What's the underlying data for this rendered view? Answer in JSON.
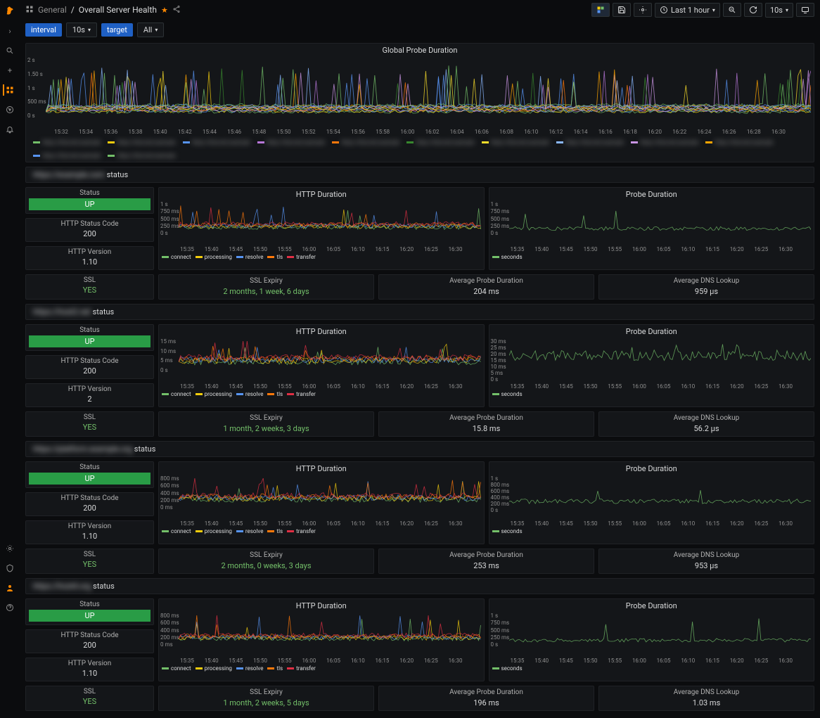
{
  "breadcrumb": {
    "icon": "panel-grid",
    "folder": "General",
    "sep": "/",
    "title": "Overall Server Health"
  },
  "topbar": {
    "timerange": "Last 1 hour",
    "refresh": "10s",
    "buttons": [
      "add-panel",
      "save",
      "settings",
      "time",
      "zoom-out",
      "cycle",
      "refresh-rate",
      "tv"
    ]
  },
  "vars": [
    {
      "label": "interval",
      "value": "10s"
    },
    {
      "label": "target",
      "value": "All"
    }
  ],
  "chart_data": {
    "global": {
      "type": "line",
      "title": "Global Probe Duration",
      "ylabel": "",
      "ylim": [
        0,
        2
      ],
      "yticks": [
        "0 s",
        "500 ms",
        "1 s",
        "1.50 s",
        "2 s"
      ],
      "xticks": [
        "15:32",
        "15:34",
        "15:36",
        "15:38",
        "15:40",
        "15:42",
        "15:44",
        "15:46",
        "15:48",
        "15:50",
        "15:52",
        "15:54",
        "15:56",
        "15:58",
        "16:00",
        "16:02",
        "16:04",
        "16:06",
        "16:08",
        "16:10",
        "16:12",
        "16:14",
        "16:16",
        "16:18",
        "16:20",
        "16:22",
        "16:24",
        "16:26",
        "16:28",
        "16:30"
      ],
      "legend_colors": [
        "#73bf69",
        "#f2cc0c",
        "#5794f2",
        "#b877d9",
        "#ff780a",
        "#37872d",
        "#fade2a",
        "#8ab8ff",
        "#ca95e5",
        "#ffa500",
        "#5794f2",
        "#73bf69"
      ],
      "series_count": 12,
      "baseline_ms": 200,
      "spike_ms": 1600
    },
    "xticks_short": [
      "15:35",
      "15:40",
      "15:45",
      "15:50",
      "15:55",
      "16:00",
      "16:05",
      "16:10",
      "16:15",
      "16:20",
      "16:25",
      "16:30"
    ],
    "http_series": [
      {
        "name": "connect",
        "color": "#73bf69"
      },
      {
        "name": "processing",
        "color": "#f2cc0c"
      },
      {
        "name": "resolve",
        "color": "#5794f2"
      },
      {
        "name": "tls",
        "color": "#ff780a"
      },
      {
        "name": "transfer",
        "color": "#e02f44"
      }
    ],
    "probe_series": [
      {
        "name": "seconds",
        "color": "#73bf69"
      }
    ]
  },
  "rows": [
    {
      "name_blurred": "https://example.com",
      "status_suffix": " status",
      "stats": {
        "status": {
          "title": "Status",
          "value": "UP"
        },
        "code": {
          "title": "HTTP Status Code",
          "value": "200"
        },
        "version": {
          "title": "HTTP Version",
          "value": "1.10"
        },
        "ssl": {
          "title": "SSL",
          "value": "YES"
        }
      },
      "http": {
        "title": "HTTP Duration",
        "yticks": [
          "0 s",
          "250 ms",
          "500 ms",
          "750 ms",
          "1 s"
        ],
        "ylim_ms": [
          0,
          1000
        ],
        "baseline_ms": 250,
        "spike_ms": 900
      },
      "probe": {
        "title": "Probe Duration",
        "yticks": [
          "0 s",
          "250 ms",
          "500 ms",
          "750 ms",
          "1 s"
        ],
        "ylim_ms": [
          0,
          1000
        ],
        "baseline_ms": 204,
        "spike_ms": 950
      },
      "expiry": {
        "title": "SSL Expiry",
        "value": "2 months, 1 week, 6 days"
      },
      "avg_probe": {
        "title": "Average Probe Duration",
        "value": "204 ms"
      },
      "avg_dns": {
        "title": "Average DNS Lookup",
        "value": "959 µs"
      }
    },
    {
      "name_blurred": "https://host2.net",
      "status_suffix": " status",
      "stats": {
        "status": {
          "title": "Status",
          "value": "UP"
        },
        "code": {
          "title": "HTTP Status Code",
          "value": "200"
        },
        "version": {
          "title": "HTTP Version",
          "value": "2"
        },
        "ssl": {
          "title": "SSL",
          "value": "YES"
        }
      },
      "http": {
        "title": "HTTP Duration",
        "yticks": [
          "0 s",
          "5 ms",
          "10 ms",
          "15 ms"
        ],
        "ylim_ms": [
          0,
          15
        ],
        "baseline_ms": 5,
        "spike_ms": 14
      },
      "probe": {
        "title": "Probe Duration",
        "yticks": [
          "0 s",
          "5 ms",
          "10 ms",
          "15 ms",
          "20 ms",
          "25 ms",
          "30 ms"
        ],
        "ylim_ms": [
          0,
          30
        ],
        "baseline_ms": 16,
        "spike_ms": 28
      },
      "expiry": {
        "title": "SSL Expiry",
        "value": "1 month, 2 weeks, 3 days"
      },
      "avg_probe": {
        "title": "Average Probe Duration",
        "value": "15.8 ms"
      },
      "avg_dns": {
        "title": "Average DNS Lookup",
        "value": "56.2 µs"
      }
    },
    {
      "name_blurred": "https://platform.example.org",
      "status_suffix": " status",
      "stats": {
        "status": {
          "title": "Status",
          "value": "UP"
        },
        "code": {
          "title": "HTTP Status Code",
          "value": "200"
        },
        "version": {
          "title": "HTTP Version",
          "value": "1.10"
        },
        "ssl": {
          "title": "SSL",
          "value": "YES"
        }
      },
      "http": {
        "title": "HTTP Duration",
        "yticks": [
          "0 ms",
          "200 ms",
          "400 ms",
          "600 ms",
          "800 ms"
        ],
        "ylim_ms": [
          0,
          800
        ],
        "baseline_ms": 250,
        "spike_ms": 750
      },
      "probe": {
        "title": "Probe Duration",
        "yticks": [
          "0 s",
          "200 ms",
          "400 ms",
          "600 ms",
          "800 ms",
          "1 s"
        ],
        "ylim_ms": [
          0,
          1000
        ],
        "baseline_ms": 253,
        "spike_ms": 950
      },
      "expiry": {
        "title": "SSL Expiry",
        "value": "2 months, 0 weeks, 3 days"
      },
      "avg_probe": {
        "title": "Average Probe Duration",
        "value": "253 ms"
      },
      "avg_dns": {
        "title": "Average DNS Lookup",
        "value": "953 µs"
      }
    },
    {
      "name_blurred": "https://host4.org",
      "status_suffix": " status",
      "stats": {
        "status": {
          "title": "Status",
          "value": "UP"
        },
        "code": {
          "title": "HTTP Status Code",
          "value": "200"
        },
        "version": {
          "title": "HTTP Version",
          "value": "1.10"
        },
        "ssl": {
          "title": "SSL",
          "value": "YES"
        }
      },
      "http": {
        "title": "HTTP Duration",
        "yticks": [
          "0 ms",
          "200 ms",
          "400 ms",
          "600 ms",
          "800 ms"
        ],
        "ylim_ms": [
          0,
          800
        ],
        "baseline_ms": 200,
        "spike_ms": 780
      },
      "probe": {
        "title": "Probe Duration",
        "yticks": [
          "0 s",
          "250 ms",
          "500 ms",
          "750 ms",
          "1 s"
        ],
        "ylim_ms": [
          0,
          1000
        ],
        "baseline_ms": 196,
        "spike_ms": 900
      },
      "expiry": {
        "title": "SSL Expiry",
        "value": "1 month, 2 weeks, 5 days"
      },
      "avg_probe": {
        "title": "Average Probe Duration",
        "value": "196 ms"
      },
      "avg_dns": {
        "title": "Average DNS Lookup",
        "value": "1.03 ms"
      }
    }
  ]
}
